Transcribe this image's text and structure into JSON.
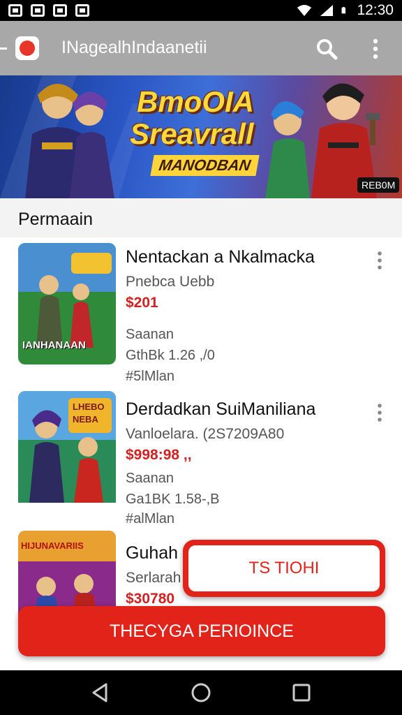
{
  "status_bar": {
    "time": "12:30"
  },
  "app_bar": {
    "title": "INagealhIndaanetii"
  },
  "banner": {
    "line1": "BmoOIA",
    "line2": "Sreavrall",
    "line3": "MANODBAN",
    "badge": "REB0M"
  },
  "section": {
    "title": "Permaain"
  },
  "items": [
    {
      "title": "Nentackan a Nkalmacka",
      "subtitle": "Pnebca Uebb",
      "price": "$201",
      "meta1": "Saanan",
      "meta2": "GthBk 1.26 ,/0",
      "meta3": "#5lMlan",
      "thumb_text": "IANHANAAN"
    },
    {
      "title": "Derdadkan SuiManiliana",
      "subtitle": "Vanloelara. (2S7209A80",
      "price": "$998:98 ,,",
      "meta1": "Saanan",
      "meta2": "Ga1BK 1.58-,B",
      "meta3": "#alMlan",
      "thumb_text": "LHEBO NEBA"
    },
    {
      "title": "Guhah",
      "subtitle": "Serlarah",
      "price": "$30780",
      "thumb_text": "HIJUNAVARIIS"
    }
  ],
  "buttons": {
    "ts_label": "TS TIOHI",
    "cta_label": "THECYGA PERIOINCE"
  },
  "colors": {
    "accent": "#e2231a",
    "app_bar": "#a8a8a8",
    "price": "#d32020"
  }
}
